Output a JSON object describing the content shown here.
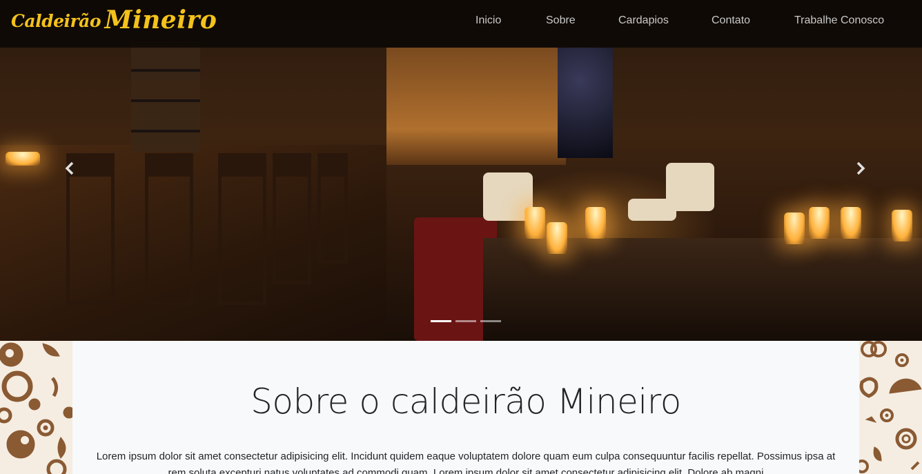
{
  "navbar": {
    "brand": {
      "part1": "Caldeirão",
      "part2": "Mineiro"
    },
    "links": [
      "Inicio",
      "Sobre",
      "Cardapios",
      "Contato",
      "Trabalhe Conosco"
    ]
  },
  "carousel": {
    "prev_icon": "chevron-left-icon",
    "next_icon": "chevron-right-icon",
    "indicator_count": 3,
    "active_indicator": 1
  },
  "about": {
    "title": "Sobre o caldeirão Mineiro",
    "paragraph": "Lorem ipsum dolor sit amet consectetur adipisicing elit. Incidunt quidem eaque voluptatem dolore quam eum culpa consequuntur facilis repellat. Possimus ipsa at rem soluta excepturi natus voluptates ad commodi quam. Lorem ipsum dolor sit amet consectetur adipisicing elit. Dolore ab magni"
  },
  "colors": {
    "brand": "#f4c21b",
    "navbar_bg": "#080604",
    "section_bg": "#f8f9fa",
    "pattern_brown": "#8a5a33"
  }
}
